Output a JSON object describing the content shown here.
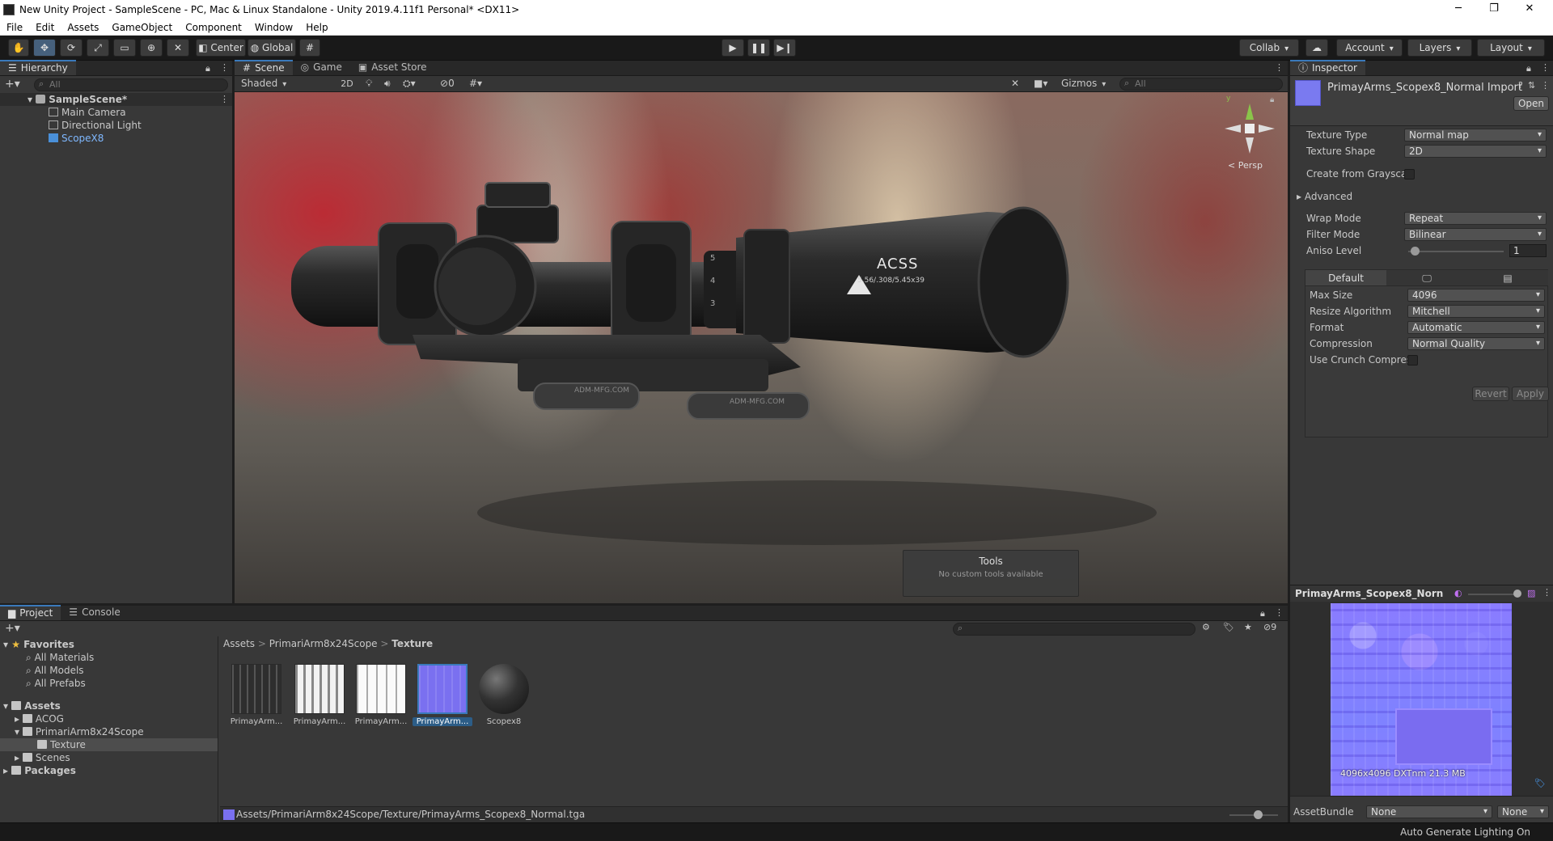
{
  "window": {
    "title": "New Unity Project - SampleScene - PC, Mac & Linux Standalone - Unity 2019.4.11f1 Personal* <DX11>",
    "controls": [
      "─",
      "❐",
      "✕"
    ]
  },
  "menubar": [
    "File",
    "Edit",
    "Assets",
    "GameObject",
    "Component",
    "Window",
    "Help"
  ],
  "toolbar": {
    "center_label": "Center",
    "global_label": "Global",
    "collab_label": "Collab",
    "account_label": "Account",
    "layers_label": "Layers",
    "layout_label": "Layout"
  },
  "hierarchy": {
    "tab": "Hierarchy",
    "search_placeholder": "All",
    "scene": "SampleScene*",
    "items": [
      "Main Camera",
      "Directional Light",
      "ScopeX8"
    ]
  },
  "scene": {
    "tabs": [
      "Scene",
      "Game",
      "Asset Store"
    ],
    "shading": "Shaded",
    "mode_2d": "2D",
    "hidden_count": "0",
    "gizmos_label": "Gizmos",
    "search_placeholder": "All",
    "persp_label": "< Persp",
    "tools_title": "Tools",
    "tools_subtitle": "No custom tools available",
    "scope_brand": "ACSS",
    "scope_sub": "5.56/.308/5.45x39",
    "mount_text": "ADM-MFG.COM",
    "dial_numbers": [
      "5",
      "4",
      "3"
    ]
  },
  "inspector": {
    "tab": "Inspector",
    "asset_title": "PrimayArms_Scopex8_Normal Import",
    "open_label": "Open",
    "fields": [
      {
        "label": "Texture Type",
        "value": "Normal map"
      },
      {
        "label": "Texture Shape",
        "value": "2D"
      }
    ],
    "create_from_grayscale": "Create from Grayscal",
    "advanced": "Advanced",
    "wrap_fields": [
      {
        "label": "Wrap Mode",
        "value": "Repeat"
      },
      {
        "label": "Filter Mode",
        "value": "Bilinear"
      }
    ],
    "aniso_label": "Aniso Level",
    "aniso_value": "1",
    "platform_tab": "Default",
    "platform_fields": [
      {
        "label": "Max Size",
        "value": "4096"
      },
      {
        "label": "Resize Algorithm",
        "value": "Mitchell"
      },
      {
        "label": "Format",
        "value": "Automatic"
      },
      {
        "label": "Compression",
        "value": "Normal Quality"
      }
    ],
    "use_crunch": "Use Crunch Compres",
    "revert_label": "Revert",
    "apply_label": "Apply",
    "preview_title": "PrimayArms_Scopex8_Norn",
    "preview_info": "4096x4096  DXTnm  21.3 MB",
    "assetbundle_label": "AssetBundle",
    "assetbundle_value": "None",
    "assetbundle_variant": "None"
  },
  "project": {
    "tabs": [
      "Project",
      "Console"
    ],
    "hidden_count": "9",
    "favorites_label": "Favorites",
    "favorites": [
      "All Materials",
      "All Models",
      "All Prefabs"
    ],
    "assets_label": "Assets",
    "assets_tree": [
      "ACOG",
      "PrimariArm8x24Scope",
      "Texture",
      "Scenes"
    ],
    "packages_label": "Packages",
    "breadcrumb": [
      "Assets",
      "PrimariArm8x24Scope",
      "Texture"
    ],
    "thumbs": [
      "PrimayArm...",
      "PrimayArm...",
      "PrimayArm...",
      "PrimayArm...",
      "Scopex8"
    ],
    "path": "Assets/PrimariArm8x24Scope/Texture/PrimayArms_Scopex8_Normal.tga"
  },
  "statusbar": {
    "text": "Auto Generate Lighting On"
  }
}
